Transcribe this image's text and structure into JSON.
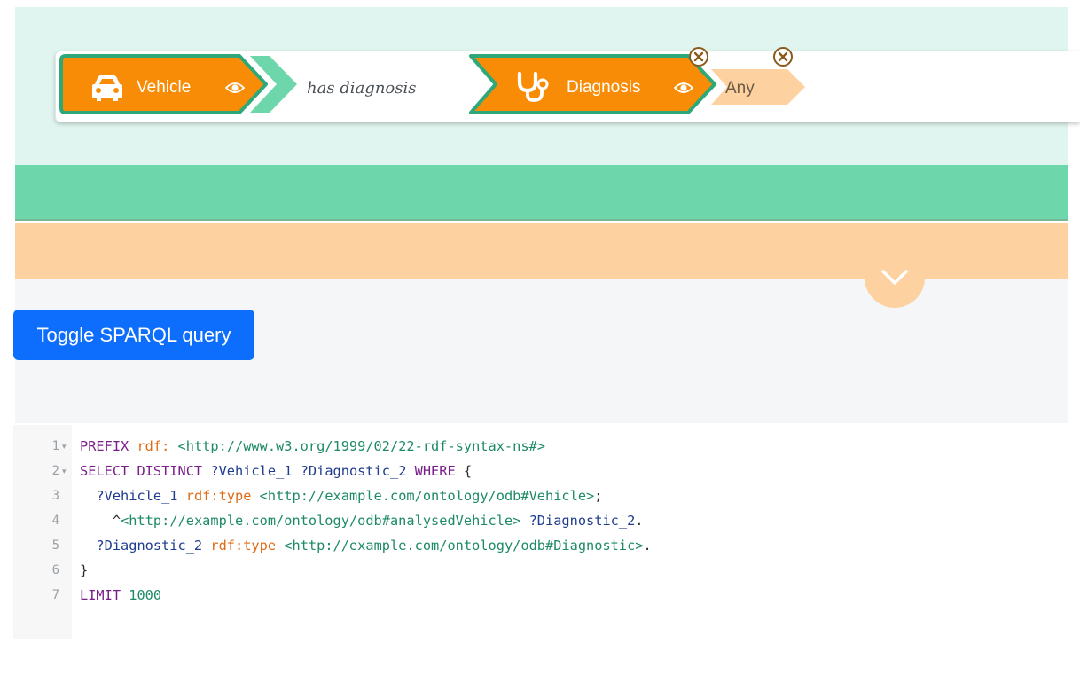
{
  "builder": {
    "subject_label": "Vehicle",
    "predicate_label": "has diagnosis",
    "object_label": "Diagnosis",
    "any_label": "Any",
    "colors": {
      "chip": "#f98c06",
      "chip_border": "#2ea879",
      "arrow": "#6ed6ab",
      "any": "#fdd2a0"
    },
    "icons": [
      "car-icon",
      "eye-icon",
      "stethoscope-icon",
      "close-icon"
    ]
  },
  "toggle_button_label": "Toggle SPARQL query",
  "editor": {
    "lines": [
      {
        "n": "1",
        "fold": "▾",
        "tokens": [
          {
            "t": "PREFIX ",
            "c": "kw"
          },
          {
            "t": "rdf:",
            "c": "pfx"
          },
          {
            "t": " ",
            "c": "plain"
          },
          {
            "t": "<http://www.w3.org/1999/02/22-rdf-syntax-ns#>",
            "c": "iri"
          }
        ]
      },
      {
        "n": "2",
        "fold": "▾",
        "tokens": [
          {
            "t": "SELECT DISTINCT ",
            "c": "kw"
          },
          {
            "t": "?Vehicle_1",
            "c": "var"
          },
          {
            "t": " ",
            "c": "plain"
          },
          {
            "t": "?Diagnostic_2",
            "c": "var"
          },
          {
            "t": " ",
            "c": "plain"
          },
          {
            "t": "WHERE",
            "c": "kw"
          },
          {
            "t": " {",
            "c": "plain"
          }
        ]
      },
      {
        "n": "3",
        "fold": "",
        "tokens": [
          {
            "t": "  ",
            "c": "plain"
          },
          {
            "t": "?Vehicle_1",
            "c": "var"
          },
          {
            "t": " ",
            "c": "plain"
          },
          {
            "t": "rdf:type",
            "c": "pfx"
          },
          {
            "t": " ",
            "c": "plain"
          },
          {
            "t": "<http://example.com/ontology/odb#Vehicle>",
            "c": "iri"
          },
          {
            "t": ";",
            "c": "plain"
          }
        ]
      },
      {
        "n": "4",
        "fold": "",
        "tokens": [
          {
            "t": "    ^",
            "c": "plain"
          },
          {
            "t": "<http://example.com/ontology/odb#analysedVehicle>",
            "c": "iri"
          },
          {
            "t": " ",
            "c": "plain"
          },
          {
            "t": "?Diagnostic_2",
            "c": "var"
          },
          {
            "t": ".",
            "c": "plain"
          }
        ]
      },
      {
        "n": "5",
        "fold": "",
        "tokens": [
          {
            "t": "  ",
            "c": "plain"
          },
          {
            "t": "?Diagnostic_2",
            "c": "var"
          },
          {
            "t": " ",
            "c": "plain"
          },
          {
            "t": "rdf:type",
            "c": "pfx"
          },
          {
            "t": " ",
            "c": "plain"
          },
          {
            "t": "<http://example.com/ontology/odb#Diagnostic>",
            "c": "iri"
          },
          {
            "t": ".",
            "c": "plain"
          }
        ]
      },
      {
        "n": "6",
        "fold": "",
        "tokens": [
          {
            "t": "}",
            "c": "plain"
          }
        ]
      },
      {
        "n": "7",
        "fold": "",
        "tokens": [
          {
            "t": "LIMIT ",
            "c": "kw"
          },
          {
            "t": "1000",
            "c": "iri"
          }
        ]
      }
    ]
  }
}
